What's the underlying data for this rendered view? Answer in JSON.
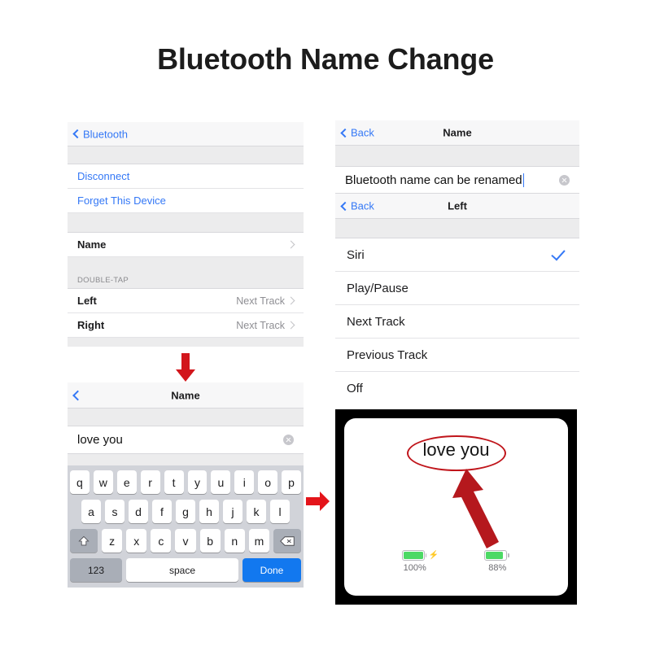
{
  "page": {
    "title": "Bluetooth Name Change"
  },
  "panel_a": {
    "name": "bluetooth-device-settings",
    "navbar": {
      "back_label": "Bluetooth"
    },
    "rows": [
      {
        "label": "Disconnect",
        "style": "blue"
      },
      {
        "label": "Forget This Device",
        "style": "blue"
      }
    ],
    "name_row": {
      "label": "Name"
    },
    "section_header": "DOUBLE-TAP",
    "double_tap": [
      {
        "label": "Left",
        "value": "Next Track"
      },
      {
        "label": "Right",
        "value": "Next Track"
      }
    ]
  },
  "panel_b": {
    "name": "name-edit-keyboard",
    "navbar": {
      "title": "Name"
    },
    "field": {
      "value": "love you"
    },
    "keyboard": {
      "row1": [
        "q",
        "w",
        "e",
        "r",
        "t",
        "y",
        "u",
        "i",
        "o",
        "p"
      ],
      "row2": [
        "a",
        "s",
        "d",
        "f",
        "g",
        "h",
        "j",
        "k",
        "l"
      ],
      "row3": [
        "z",
        "x",
        "c",
        "v",
        "b",
        "n",
        "m"
      ],
      "shift_label": "shift-key",
      "delete_label": "delete-key",
      "num_label": "123",
      "space_label": "space",
      "done_label": "Done"
    }
  },
  "panel_c": {
    "name": "name-field-and-left-action-list",
    "navbar_name": {
      "back_label": "Back",
      "title": "Name"
    },
    "field": {
      "value": "Bluetooth name can be renamed"
    },
    "navbar_left": {
      "back_label": "Back",
      "title": "Left"
    },
    "options": [
      {
        "label": "Siri",
        "selected": true
      },
      {
        "label": "Play/Pause",
        "selected": false
      },
      {
        "label": "Next Track",
        "selected": false
      },
      {
        "label": "Previous Track",
        "selected": false
      },
      {
        "label": "Off",
        "selected": false
      }
    ]
  },
  "panel_d": {
    "name": "earbuds-case-photo",
    "device_name": "love you",
    "batteries": [
      {
        "percent_label": "100%",
        "fill": 100,
        "charging": true
      },
      {
        "percent_label": "88%",
        "fill": 88,
        "charging": false
      }
    ]
  },
  "annotations": {
    "arrow_down": "red-down-arrow",
    "arrow_right": "red-right-arrow",
    "highlight_ellipse": "red-ellipse-highlight",
    "photo_arrow": "red-pointer-arrow"
  },
  "colors": {
    "ios_blue": "#3478f6",
    "done_blue": "#1278ef",
    "annotation_red": "#d2161c",
    "battery_green": "#4cd964"
  }
}
